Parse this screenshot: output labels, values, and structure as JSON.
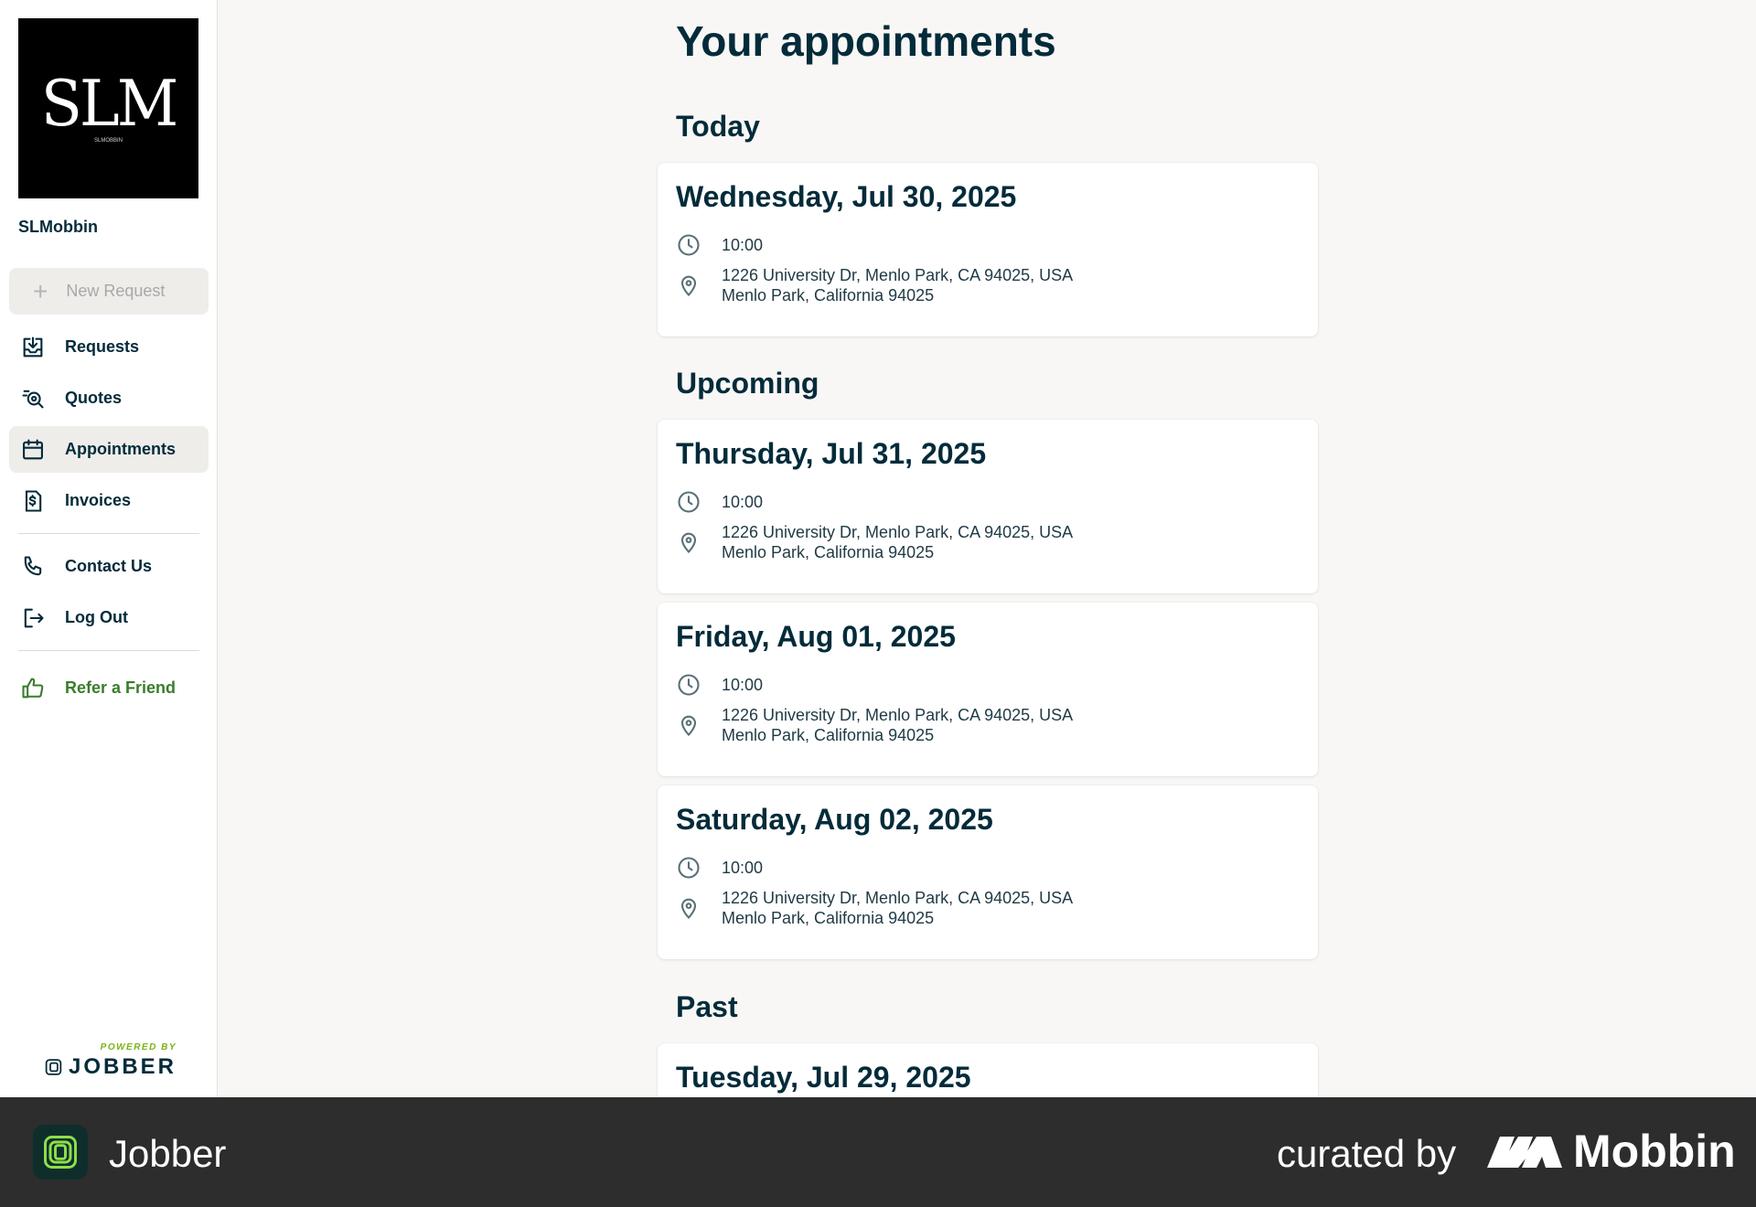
{
  "sidebar": {
    "logo_text": "SLM",
    "logo_sub": "SLMOBBIN",
    "company_name": "SLMobbin",
    "new_request_label": "New Request",
    "nav": [
      {
        "label": "Requests",
        "icon": "inbox-download-icon"
      },
      {
        "label": "Quotes",
        "icon": "quote-search-icon"
      },
      {
        "label": "Appointments",
        "icon": "calendar-icon",
        "active": true
      },
      {
        "label": "Invoices",
        "icon": "invoice-dollar-icon"
      }
    ],
    "secondary": [
      {
        "label": "Contact Us",
        "icon": "phone-icon"
      },
      {
        "label": "Log Out",
        "icon": "logout-icon"
      }
    ],
    "refer_label": "Refer a Friend",
    "powered_by": "POWERED BY",
    "powered_brand": "JOBBER"
  },
  "main": {
    "title": "Your appointments",
    "sections": {
      "today": "Today",
      "upcoming": "Upcoming",
      "past": "Past"
    },
    "appointments": [
      {
        "date": "Wednesday, Jul 30, 2025",
        "time": "10:00",
        "address_line1": "1226 University Dr, Menlo Park, CA 94025, USA",
        "address_line2": "Menlo Park, California 94025"
      },
      {
        "date": "Thursday, Jul 31, 2025",
        "time": "10:00",
        "address_line1": "1226 University Dr, Menlo Park, CA 94025, USA",
        "address_line2": "Menlo Park, California 94025"
      },
      {
        "date": "Friday, Aug 01, 2025",
        "time": "10:00",
        "address_line1": "1226 University Dr, Menlo Park, CA 94025, USA",
        "address_line2": "Menlo Park, California 94025"
      },
      {
        "date": "Saturday, Aug 02, 2025",
        "time": "10:00",
        "address_line1": "1226 University Dr, Menlo Park, CA 94025, USA",
        "address_line2": "Menlo Park, California 94025"
      },
      {
        "date": "Tuesday, Jul 29, 2025"
      }
    ]
  },
  "footer": {
    "app_name": "Jobber",
    "curated_by": "curated by",
    "brand": "Mobbin"
  },
  "colors": {
    "text_primary": "#032b3a",
    "refer_green": "#3a7d2c",
    "jobber_green": "#7ab317",
    "background": "#f8f7f5",
    "footer_bg": "#2d2d2d"
  }
}
